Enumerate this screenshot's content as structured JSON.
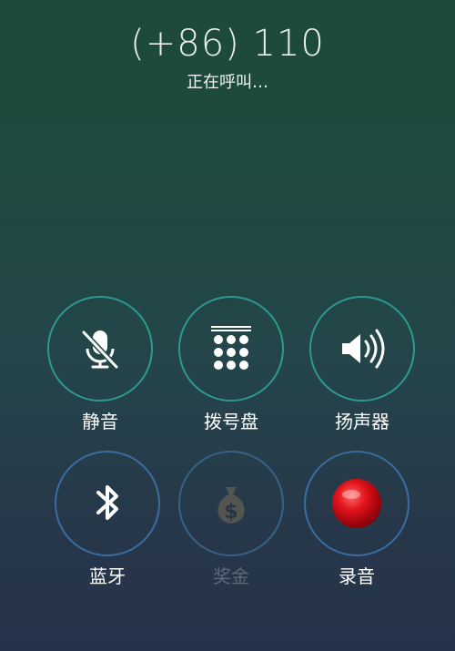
{
  "call": {
    "number": "(+86) 110",
    "status": "正在呼叫…"
  },
  "actions": [
    {
      "id": "mute",
      "label": "静音",
      "icon": "mic-off-icon",
      "enabled": true
    },
    {
      "id": "keypad",
      "label": "拨号盘",
      "icon": "keypad-icon",
      "enabled": true
    },
    {
      "id": "speaker",
      "label": "扬声器",
      "icon": "speaker-icon",
      "enabled": true
    },
    {
      "id": "bluetooth",
      "label": "蓝牙",
      "icon": "bluetooth-icon",
      "enabled": true
    },
    {
      "id": "bonus",
      "label": "奖金",
      "icon": "money-bag-icon",
      "enabled": false
    },
    {
      "id": "record",
      "label": "录音",
      "icon": "record-icon",
      "enabled": true
    }
  ],
  "colors": {
    "ring_teal": "#2c9b8b",
    "ring_blue": "#3a6ea3",
    "record_red": "#e0121a",
    "disabled_label": "#5d6a79"
  }
}
